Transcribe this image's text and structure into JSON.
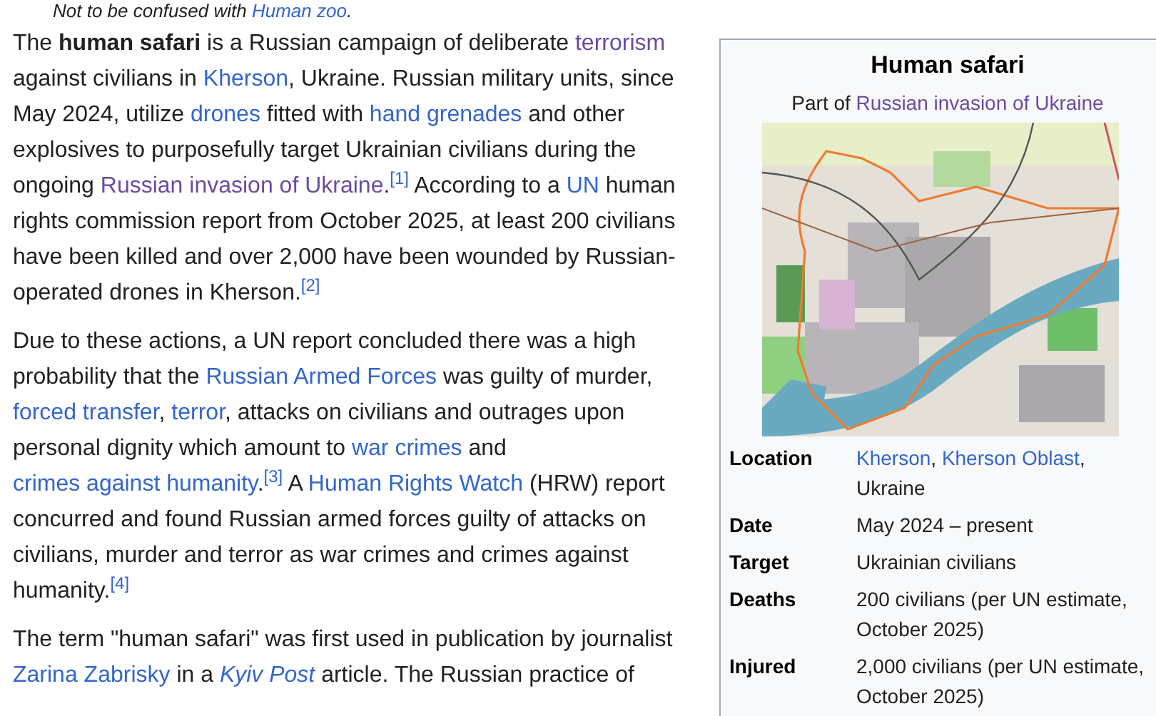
{
  "hatnote": [
    {
      "kind": "text",
      "text": "Not to be confused with "
    },
    {
      "kind": "link",
      "text": "Human zoo",
      "visited": false
    },
    {
      "kind": "text",
      "text": "."
    }
  ],
  "paragraphs": [
    [
      {
        "kind": "text",
        "text": "The "
      },
      {
        "kind": "bold",
        "text": "human safari"
      },
      {
        "kind": "text",
        "text": " is a Russian campaign of deliberate "
      },
      {
        "kind": "link",
        "text": "terrorism",
        "visited": true
      },
      {
        "kind": "text",
        "text": " against civilians in "
      },
      {
        "kind": "link",
        "text": "Kherson",
        "visited": false
      },
      {
        "kind": "text",
        "text": ", Ukraine. Russian military units, since May 2024, utilize "
      },
      {
        "kind": "link",
        "text": "drones",
        "visited": false
      },
      {
        "kind": "text",
        "text": " fitted with "
      },
      {
        "kind": "link",
        "text": "hand grenades",
        "visited": false
      },
      {
        "kind": "text",
        "text": " and other explosives to purposefully target Ukrainian civilians during the ongoing "
      },
      {
        "kind": "link",
        "text": "Russian invasion of Ukraine",
        "visited": true
      },
      {
        "kind": "text",
        "text": "."
      },
      {
        "kind": "ref",
        "text": "[1]"
      },
      {
        "kind": "text",
        "text": " According to a "
      },
      {
        "kind": "link",
        "text": "UN",
        "visited": false
      },
      {
        "kind": "text",
        "text": " human rights commission report from October 2025, at least 200 civilians have been killed and over 2,000 have been wounded by Russian-operated drones in Kherson."
      },
      {
        "kind": "ref",
        "text": "[2]"
      }
    ],
    [
      {
        "kind": "text",
        "text": "Due to these actions, a UN report concluded there was a high probability that the "
      },
      {
        "kind": "link",
        "text": "Russian Armed Forces",
        "visited": false
      },
      {
        "kind": "text",
        "text": " was guilty of murder, "
      },
      {
        "kind": "link",
        "text": "forced transfer",
        "visited": false
      },
      {
        "kind": "text",
        "text": ", "
      },
      {
        "kind": "link",
        "text": "terror",
        "visited": false
      },
      {
        "kind": "text",
        "text": ", attacks on civilians and outrages upon personal dignity which amount to "
      },
      {
        "kind": "link",
        "text": "war crimes",
        "visited": false
      },
      {
        "kind": "text",
        "text": " and "
      },
      {
        "kind": "link",
        "text": "crimes against humanity",
        "visited": false
      },
      {
        "kind": "text",
        "text": "."
      },
      {
        "kind": "ref",
        "text": "[3]"
      },
      {
        "kind": "text",
        "text": " A "
      },
      {
        "kind": "link",
        "text": "Human Rights Watch",
        "visited": false
      },
      {
        "kind": "text",
        "text": " (HRW) report concurred and found Russian armed forces guilty of attacks on civilians, murder and terror as war crimes and crimes against humanity."
      },
      {
        "kind": "ref",
        "text": "[4]"
      }
    ],
    [
      {
        "kind": "text",
        "text": "The term \"human safari\" was first used in publication by journalist "
      },
      {
        "kind": "link",
        "text": "Zarina Zabrisky",
        "visited": false
      },
      {
        "kind": "text",
        "text": " in a "
      },
      {
        "kind": "italic-link",
        "text": "Kyiv Post",
        "visited": false
      },
      {
        "kind": "text",
        "text": " article. The Russian practice of"
      }
    ]
  ],
  "infobox": {
    "title": "Human safari",
    "subtitle": [
      {
        "kind": "text",
        "text": "Part of "
      },
      {
        "kind": "link",
        "text": "Russian invasion of Ukraine",
        "visited": true
      }
    ],
    "rows": [
      {
        "label": "Location",
        "value": [
          {
            "kind": "link",
            "text": "Kherson",
            "visited": false
          },
          {
            "kind": "text",
            "text": ", "
          },
          {
            "kind": "link",
            "text": "Kherson Oblast",
            "visited": false
          },
          {
            "kind": "text",
            "text": ", Ukraine"
          }
        ]
      },
      {
        "label": "Date",
        "value": [
          {
            "kind": "text",
            "text": "May 2024 – present"
          }
        ]
      },
      {
        "label": "Target",
        "value": [
          {
            "kind": "text",
            "text": "Ukrainian civilians"
          }
        ]
      },
      {
        "label": "Deaths",
        "value": [
          {
            "kind": "text",
            "text": "200 civilians (per UN estimate, October 2025)"
          }
        ]
      },
      {
        "label": "Injured",
        "value": [
          {
            "kind": "text",
            "text": "2,000 civilians (per UN estimate, October 2025)"
          }
        ]
      }
    ]
  }
}
